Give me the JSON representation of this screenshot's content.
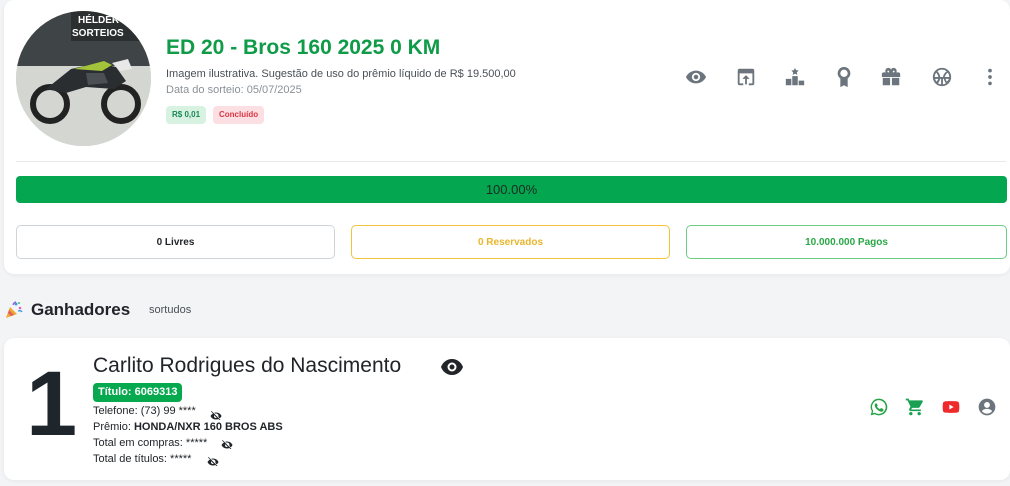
{
  "raffle": {
    "title": "ED 20 - Bros 160 2025 0 KM",
    "description": "Imagem ilustrativa. Sugestão de uso do prêmio líquido de R$ 19.500,00",
    "draw_date": "Data do sorteio: 05/07/2025",
    "price_badge": "R$ 0,01",
    "status_badge": "Concluído",
    "image_watermark": "HELDER SORTEIOS"
  },
  "actions": [
    {
      "icon": "eye-icon"
    },
    {
      "icon": "open-external-icon"
    },
    {
      "icon": "podium-icon"
    },
    {
      "icon": "award-icon"
    },
    {
      "icon": "gift-icon"
    },
    {
      "icon": "ball-icon"
    },
    {
      "icon": "more-vertical-icon"
    }
  ],
  "progress": {
    "value": 100,
    "label": "100.00%",
    "color": "#04a650"
  },
  "stats": {
    "free": "0 Livres",
    "reserved": "0 Reservados",
    "paid": "10.000.000 Pagos"
  },
  "winners": {
    "title": "Ganhadores",
    "subtitle": "sortudos",
    "list": [
      {
        "rank": "1",
        "name": "Carlito Rodrigues do Nascimento",
        "ticket": "Título: 6069313",
        "phone_label": "Telefone: ",
        "phone_value": "(73) 99 ****",
        "prize_label": "Prêmio: ",
        "prize_value": "HONDA/NXR 160 BROS ABS",
        "total_purchases": "Total em compras: *****",
        "total_titles": "Total de títulos: *****"
      }
    ]
  },
  "colors": {
    "brand_green": "#0f9b48",
    "whatsapp": "#25a244",
    "cart": "#1aa053",
    "youtube": "#ee2a2a",
    "account": "#6c757d"
  }
}
